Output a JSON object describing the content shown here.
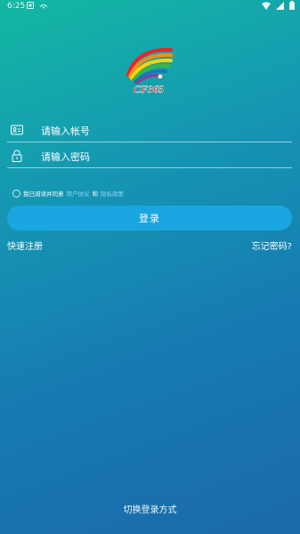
{
  "status_bar": {
    "time": "6:25"
  },
  "logo": {
    "text": "CF365"
  },
  "account_field": {
    "placeholder": "请输入帐号"
  },
  "password_field": {
    "placeholder": "请输入密码"
  },
  "agreement": {
    "prefix": "我已阅读并同意",
    "user_agreement": "用户协议",
    "conjunction": "和",
    "privacy_policy": "隐私政策"
  },
  "login_button": {
    "label": "登录"
  },
  "quick_register": {
    "label": "快速注册"
  },
  "forgot_password": {
    "label": "忘记密码?"
  },
  "switch_login": {
    "label": "切换登录方式"
  },
  "colors": {
    "accent_button": "#1aa6e0",
    "link_highlight": "#8fd6f2"
  }
}
